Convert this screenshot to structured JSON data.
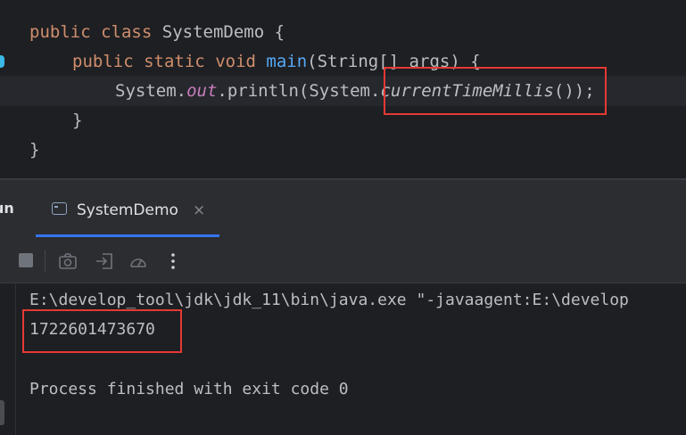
{
  "editor": {
    "lines": [
      {
        "kw1": "public",
        "kw2": "class",
        "rest": "SystemDemo {"
      },
      {
        "kw1": "public",
        "kw2": "static",
        "kw3": "void",
        "fn": "main",
        "rest": "(String[] args) {"
      },
      {
        "p1": "System.",
        "field": "out",
        "p2": ".println(System.",
        "method": "currentTimeMillis",
        "p3": "());"
      },
      {
        "text": "}"
      },
      {
        "text": "}"
      }
    ]
  },
  "run_panel": {
    "label": "un",
    "tab_label": "SystemDemo",
    "tab_close": "×"
  },
  "console": {
    "command": "E:\\develop_tool\\jdk\\jdk_11\\bin\\java.exe \"-javaagent:E:\\develop",
    "output": "1722601473670",
    "exit_message": "Process finished with exit code 0"
  },
  "colors": {
    "keyword": "#cf8e6d",
    "function": "#56a8f5",
    "static_field": "#c77dbb",
    "highlight_box": "#e53935",
    "tab_underline": "#3574f0"
  },
  "icons": [
    "stop-icon",
    "camera-icon",
    "export-icon",
    "gauge-icon",
    "more-vertical-icon",
    "terminal-tab-icon",
    "close-icon"
  ]
}
